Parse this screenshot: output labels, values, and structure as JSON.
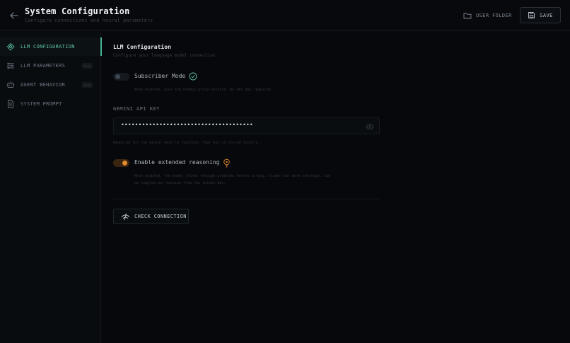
{
  "header": {
    "title": "System Configuration",
    "subtitle": "Configure connections and neural parameters",
    "user_folder_label": "USER FOLDER",
    "save_label": "SAVE"
  },
  "sidebar": {
    "items": [
      {
        "label": "LLM CONFIGURATION",
        "icon": "chip-icon",
        "active": true
      },
      {
        "label": "LLM PARAMETERS",
        "icon": "sliders-icon",
        "badge": "soon"
      },
      {
        "label": "AGENT BEHAVIOR",
        "icon": "robot-icon",
        "badge": "soon"
      },
      {
        "label": "SYSTEM PROMPT",
        "icon": "document-icon"
      }
    ]
  },
  "main": {
    "section_title": "LLM Configuration",
    "section_subtitle": "Configure your language model connection",
    "subscriber": {
      "label": "Subscriber Mode",
      "enabled": false,
      "help": "When enabled, uses the Kimbus proxy service. No API key required."
    },
    "api_key": {
      "label": "GEMINI API KEY",
      "value": "••••••••••••••••••••••••••••••••••••••",
      "help": "Required for the neural mesh to function. Your key is stored locally."
    },
    "reasoning": {
      "label": "Enable extended reasoning",
      "enabled": true,
      "help_line1": "When enabled, the model thinks through problems before acting. Slower but more thorough. Can",
      "help_line2": "be toggled per-session from the intent bar."
    },
    "check_label": "CHECK CONNECTION"
  },
  "colors": {
    "accent_green": "#5fc3a6",
    "accent_orange": "#e58a2b",
    "background": "#06080b"
  }
}
